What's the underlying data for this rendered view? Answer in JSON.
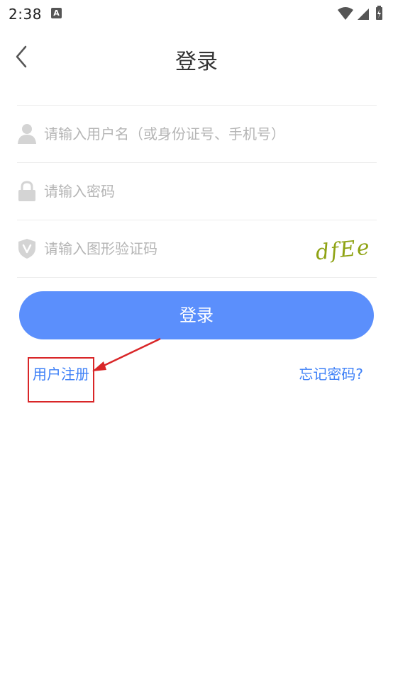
{
  "status_bar": {
    "time": "2:38",
    "notification_icon": "A"
  },
  "nav": {
    "back_icon": "chevron-left-icon",
    "title": "登录"
  },
  "form": {
    "username": {
      "placeholder": "请输入用户名（或身份证号、手机号）",
      "icon": "user-icon"
    },
    "password": {
      "placeholder": "请输入密码",
      "icon": "lock-icon"
    },
    "captcha": {
      "placeholder": "请输入图形验证码",
      "icon": "shield-v-icon",
      "image_text": "dfEe"
    }
  },
  "login_button": "登录",
  "links": {
    "register": "用户注册",
    "forgot": "忘记密码?"
  },
  "colors": {
    "accent": "#5b8ffc",
    "link": "#3e80f7",
    "annotation": "#d92628"
  }
}
